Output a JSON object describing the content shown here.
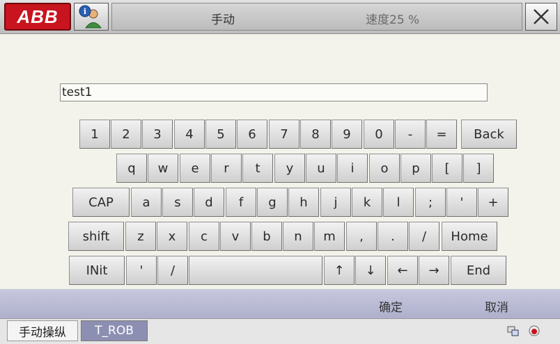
{
  "header": {
    "brand": "ABB",
    "mode": "手动",
    "speed": "速度25 %",
    "user_icon": "user-info-icon",
    "close_icon": "close-icon"
  },
  "input": {
    "value": "test1"
  },
  "keyboard": {
    "row1": [
      "1",
      "2",
      "3",
      "4",
      "5",
      "6",
      "7",
      "8",
      "9",
      "0",
      "-",
      "=",
      "Back"
    ],
    "row2": [
      "q",
      "w",
      "e",
      "r",
      "t",
      "y",
      "u",
      "i",
      "o",
      "p",
      "[",
      "]"
    ],
    "row3": [
      "CAP",
      "a",
      "s",
      "d",
      "f",
      "g",
      "h",
      "j",
      "k",
      "l",
      ";",
      "'",
      "+"
    ],
    "row4": [
      "shift",
      "z",
      "x",
      "c",
      "v",
      "b",
      "n",
      "m",
      ",",
      ".",
      "/",
      "Home"
    ],
    "row5": [
      "INit",
      "'",
      "/",
      "",
      "↑",
      "↓",
      "←",
      "→",
      "End"
    ]
  },
  "actions": {
    "ok": "确定",
    "cancel": "取消"
  },
  "taskbar": {
    "tab_jog": "手动操纵",
    "tab_task": "T_ROB"
  },
  "colors": {
    "brand": "#c8141e",
    "actionbar": "#aeb0cc",
    "active_tab": "#8d8fb2"
  }
}
